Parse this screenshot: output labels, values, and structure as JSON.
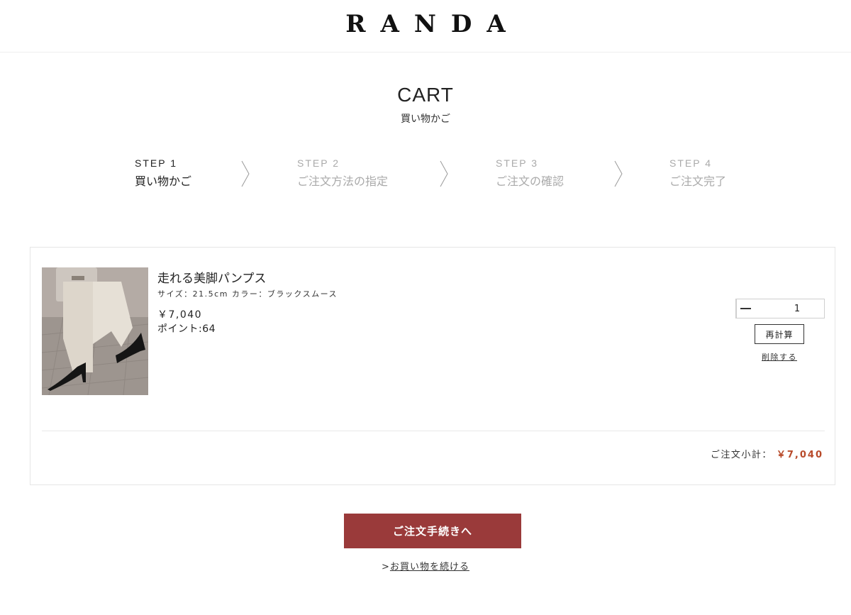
{
  "header": {
    "logo": "RANDA"
  },
  "page": {
    "title": "CART",
    "subtitle": "買い物かご"
  },
  "steps": [
    {
      "num": "STEP 1",
      "label": "買い物かご",
      "active": true
    },
    {
      "num": "STEP 2",
      "label": "ご注文方法の指定",
      "active": false
    },
    {
      "num": "STEP 3",
      "label": "ご注文の確認",
      "active": false
    },
    {
      "num": "STEP 4",
      "label": "ご注文完了",
      "active": false
    }
  ],
  "cart": {
    "item": {
      "name": "走れる美脚パンプス",
      "variant": "サイズ：21.5cm カラー：ブラックスムース",
      "price": "￥7,040",
      "points": "ポイント:64",
      "quantity": "1",
      "recalc_label": "再計算",
      "delete_label": "削除する"
    },
    "subtotal_label": "ご注文小計：",
    "subtotal_value": "￥7,040"
  },
  "actions": {
    "checkout_label": "ご注文手続きへ",
    "continue_prefix": ">",
    "continue_label": "お買い物を続ける"
  },
  "colors": {
    "accent": "#9a3a3a",
    "price_accent": "#b84a2a"
  }
}
